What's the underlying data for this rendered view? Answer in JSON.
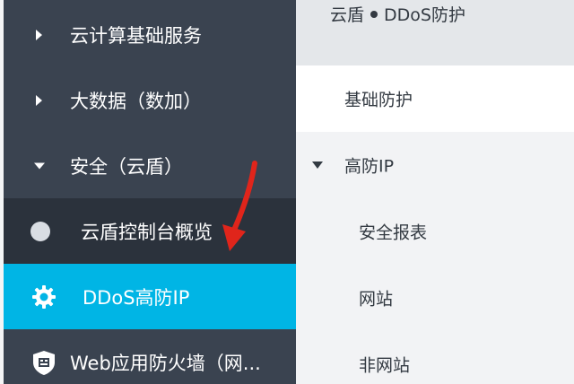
{
  "sidebar": {
    "items": [
      {
        "label": "云计算基础服务",
        "expanded": false
      },
      {
        "label": "大数据（数加）",
        "expanded": false
      },
      {
        "label": "安全（云盾）",
        "expanded": true
      },
      {
        "label": "云盾控制台概览",
        "icon": "circle-icon"
      },
      {
        "label": "DDoS高防IP",
        "icon": "gear-icon",
        "active": true
      },
      {
        "label": "Web应用防火墙（网...",
        "icon": "shield-icon"
      }
    ]
  },
  "header": {
    "crumb_parent": "云盾",
    "crumb_current": "DDoS防护"
  },
  "subnav": {
    "items": [
      {
        "label": "基础防护",
        "selected": true
      },
      {
        "label": "高防IP",
        "expanded": true
      },
      {
        "label": "安全报表"
      },
      {
        "label": "网站"
      },
      {
        "label": "非网站"
      }
    ]
  },
  "colors": {
    "sidebar_bg": "#3a4350",
    "sidebar_sub_bg": "#2b323c",
    "active_bg": "#00b5e5",
    "annotation": "#e0251b"
  }
}
